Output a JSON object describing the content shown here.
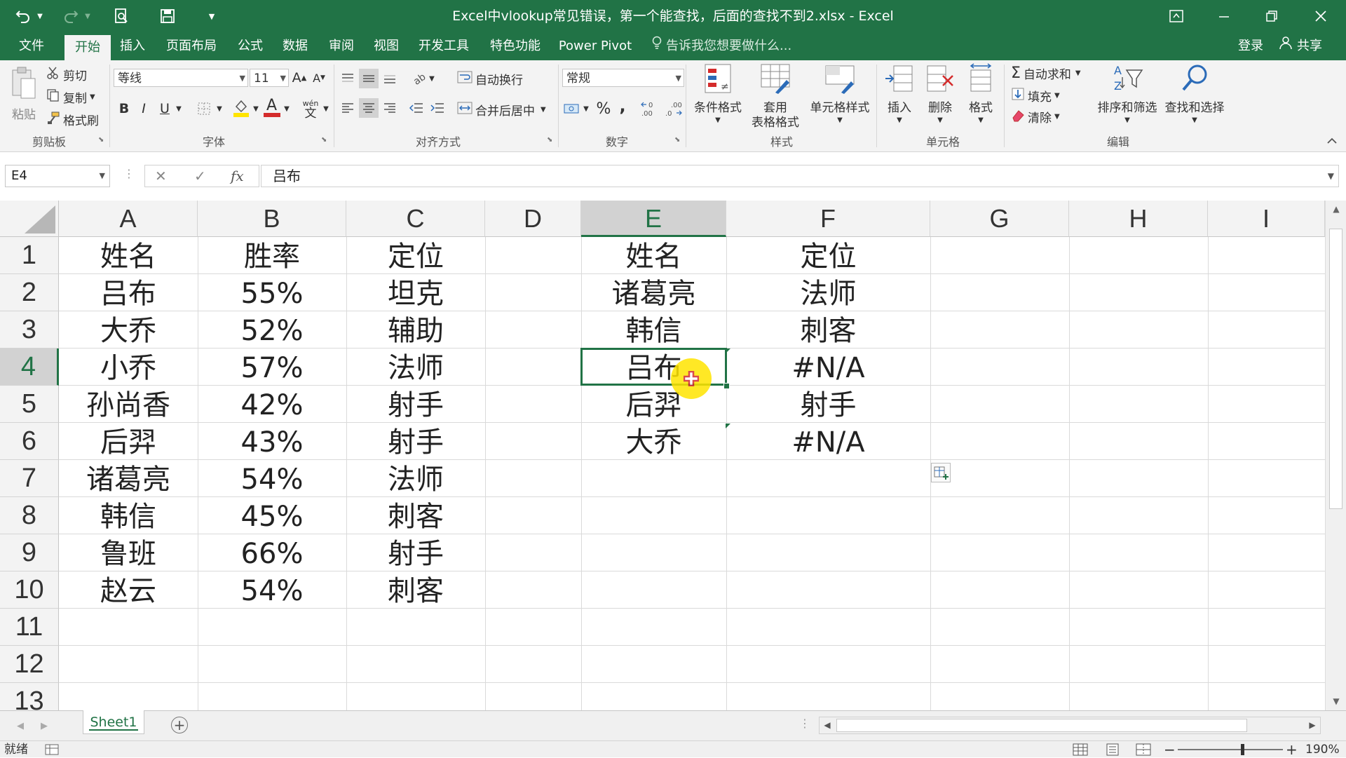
{
  "app": {
    "title": "Excel中vlookup常见错误，第一个能查找，后面的查找不到2.xlsx - Excel",
    "quick_access": {
      "undo_icon": "undo-icon",
      "redo_icon": "redo-icon",
      "print_preview_icon": "print-preview-icon",
      "save_icon": "save-icon",
      "customize_icon": "chevron-down-icon"
    },
    "window_controls": [
      "ribbon-display-icon",
      "minimize-icon",
      "restore-icon",
      "close-icon"
    ]
  },
  "tabs": {
    "items": [
      "文件",
      "开始",
      "插入",
      "页面布局",
      "公式",
      "数据",
      "审阅",
      "视图",
      "开发工具",
      "特色功能",
      "Power Pivot"
    ],
    "active": "开始",
    "tell_me": "告诉我您想要做什么...",
    "login": "登录",
    "share": "共享"
  },
  "ribbon": {
    "clipboard": {
      "label": "剪贴板",
      "paste": "粘贴",
      "cut": "剪切",
      "copy": "复制",
      "format_painter": "格式刷"
    },
    "font": {
      "label": "字体",
      "font_name": "等线",
      "font_size": "11",
      "bold": "B",
      "italic": "I",
      "underline": "U",
      "font_color": "A",
      "phonetic": "wén"
    },
    "alignment": {
      "label": "对齐方式",
      "wrap_text": "自动换行",
      "merge_center": "合并后居中"
    },
    "number": {
      "label": "数字",
      "format": "常规",
      "percent": "%",
      "comma": ","
    },
    "styles": {
      "label": "样式",
      "conditional": "条件格式",
      "table_format_1": "套用",
      "table_format_2": "表格格式",
      "cell_styles": "单元格样式"
    },
    "cells": {
      "label": "单元格",
      "insert": "插入",
      "delete": "删除",
      "format": "格式"
    },
    "editing": {
      "label": "编辑",
      "autosum": "自动求和",
      "fill": "填充",
      "clear": "清除",
      "sort_filter": "排序和筛选",
      "find_select": "查找和选择"
    }
  },
  "formula_bar": {
    "name_box": "E4",
    "fx": "fx",
    "content": "吕布"
  },
  "grid": {
    "columns": [
      "A",
      "B",
      "C",
      "D",
      "E",
      "F",
      "G",
      "H",
      "I"
    ],
    "selected_column": "E",
    "rows": [
      "1",
      "2",
      "3",
      "4",
      "5",
      "6",
      "7",
      "8",
      "9",
      "10",
      "11",
      "12",
      "13"
    ],
    "selected_row": "4",
    "table1": [
      [
        "姓名",
        "胜率",
        "定位"
      ],
      [
        "吕布",
        "55%",
        "坦克"
      ],
      [
        "大乔",
        "52%",
        "辅助"
      ],
      [
        "小乔",
        "57%",
        "法师"
      ],
      [
        "孙尚香",
        "42%",
        "射手"
      ],
      [
        "后羿",
        "43%",
        "射手"
      ],
      [
        "诸葛亮",
        "54%",
        "法师"
      ],
      [
        "韩信",
        "45%",
        "刺客"
      ],
      [
        "鲁班",
        "66%",
        "射手"
      ],
      [
        "赵云",
        "54%",
        "刺客"
      ]
    ],
    "table2": [
      [
        "姓名",
        "定位"
      ],
      [
        "诸葛亮",
        "法师"
      ],
      [
        "韩信",
        "刺客"
      ],
      [
        "吕布",
        "#N/A"
      ],
      [
        "后羿",
        "射手"
      ],
      [
        "大乔",
        "#N/A"
      ]
    ],
    "active_cell": "E4"
  },
  "sheets": {
    "tabs": [
      "Sheet1"
    ],
    "active": "Sheet1"
  },
  "status": {
    "ready": "就绪",
    "zoom": "190%"
  },
  "colors": {
    "accent": "#217346",
    "cursor_highlight": "#ffe400",
    "error_red": "#d42b2b"
  }
}
